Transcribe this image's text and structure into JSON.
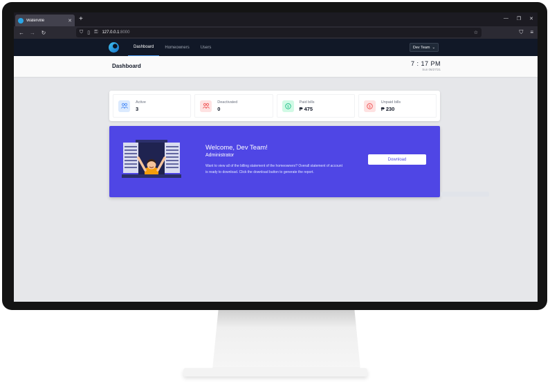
{
  "browser": {
    "tab_title": "Waterville",
    "url_host": "127.0.0.1",
    "url_port": ":8000"
  },
  "appnav": {
    "tabs": [
      {
        "label": "Dashboard",
        "active": true
      },
      {
        "label": "Homeowners",
        "active": false
      },
      {
        "label": "Users",
        "active": false
      }
    ],
    "user_menu": "Dev Team"
  },
  "header": {
    "title": "Dashboard",
    "time": "7 : 17 PM",
    "date": "Sun 06/27/21"
  },
  "stats": [
    {
      "label": "Active",
      "value": "3",
      "icon": "users-icon",
      "icon_color": "#3b82f6",
      "icon_bg": "#dbeafe"
    },
    {
      "label": "Deactivated",
      "value": "0",
      "icon": "users-icon",
      "icon_color": "#ef4444",
      "icon_bg": "#fee2e2"
    },
    {
      "label": "Paid bills",
      "value": "₱ 475",
      "icon": "dollar-icon",
      "icon_color": "#10b981",
      "icon_bg": "#d1fae5"
    },
    {
      "label": "Unpaid bills",
      "value": "₱ 230",
      "icon": "dollar-icon",
      "icon_color": "#ef4444",
      "icon_bg": "#fee2e2"
    }
  ],
  "welcome": {
    "title": "Welcome, Dev Team!",
    "role": "Administrator",
    "text": "Want to view all of the billing statement of the homeowners? Overall statement of account is ready to download. Click the download button to generate the report.",
    "button": "Download",
    "banner_color": "#4f46e5"
  }
}
